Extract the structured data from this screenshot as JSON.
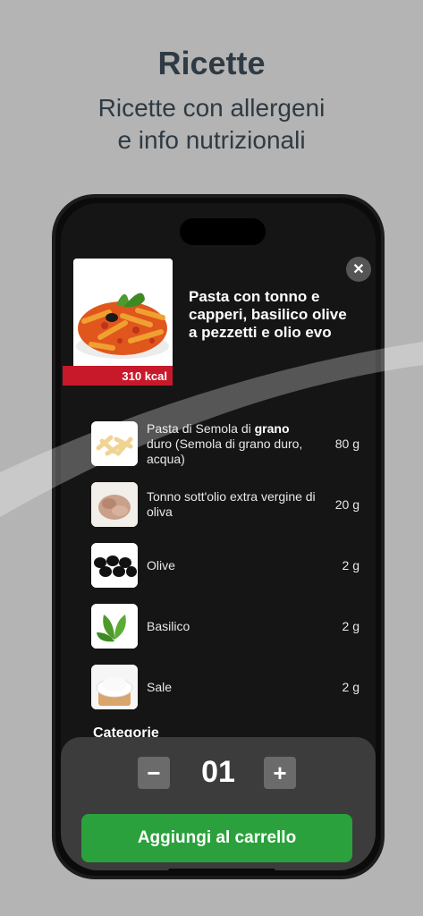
{
  "hero": {
    "title": "Ricette",
    "subtitle_line1": "Ricette con allergeni",
    "subtitle_line2": "e info nutrizionali"
  },
  "dish": {
    "image_icon": "pasta-dish-icon",
    "kcal": "310 kcal",
    "title": "Pasta con tonno e capperi, basilico olive a pezzetti e olio evo",
    "close_icon": "close-icon"
  },
  "ingredients": [
    {
      "name_pre": "Pasta di Semola di ",
      "name_bold": "grano",
      "name_post": " duro (Semola di grano duro, acqua)",
      "qty": "80 g",
      "icon": "pasta-icon"
    },
    {
      "name_pre": "Tonno sott'olio extra vergine di oliva",
      "name_bold": "",
      "name_post": "",
      "qty": "20 g",
      "icon": "tuna-icon"
    },
    {
      "name_pre": "Olive",
      "name_bold": "",
      "name_post": "",
      "qty": "2 g",
      "icon": "olives-icon"
    },
    {
      "name_pre": "Basilico",
      "name_bold": "",
      "name_post": "",
      "qty": "2 g",
      "icon": "basil-icon"
    },
    {
      "name_pre": "Sale",
      "name_bold": "",
      "name_post": "",
      "qty": "2 g",
      "icon": "salt-icon"
    }
  ],
  "categories_label": "Categorie",
  "cart": {
    "minus": "−",
    "plus": "+",
    "quantity": "01",
    "add_label": "Aggiungi al carrello"
  },
  "colors": {
    "background": "#b3b4b3",
    "kcal_badge": "#c8192b",
    "add_button": "#2aa13c"
  }
}
